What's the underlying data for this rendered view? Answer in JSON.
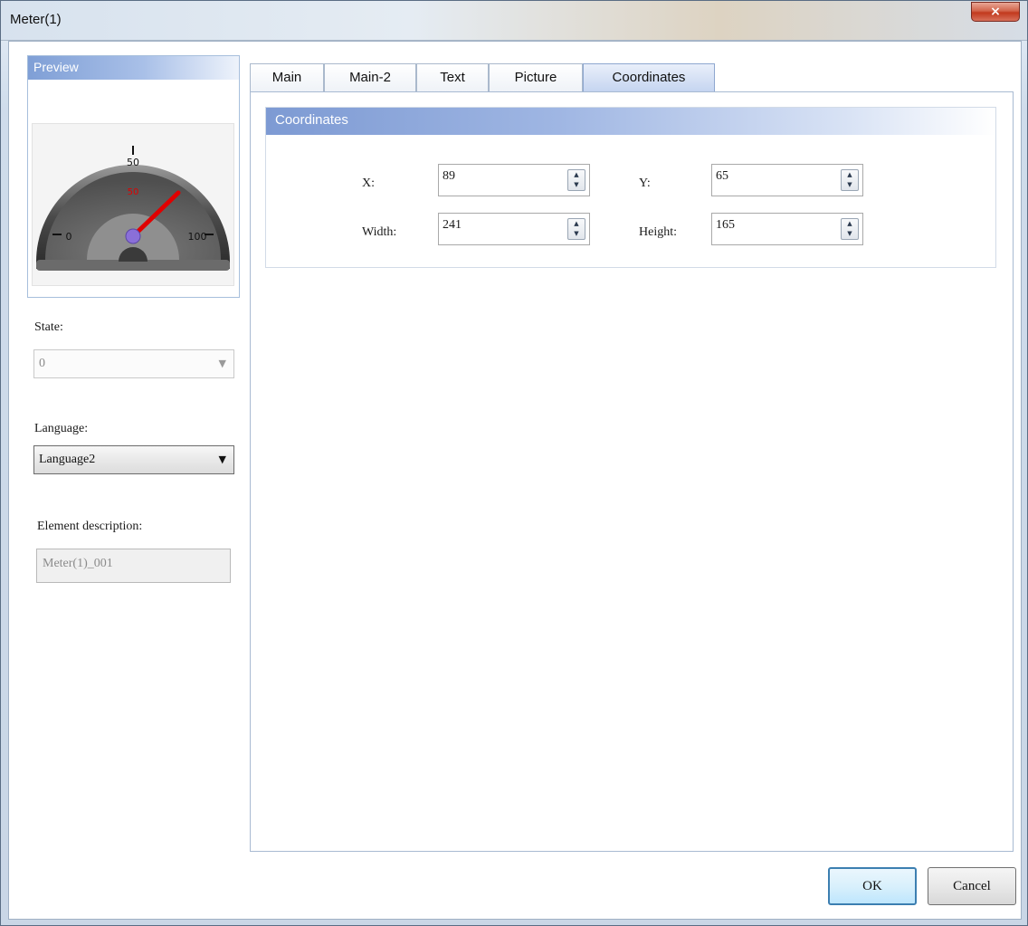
{
  "window": {
    "title": "Meter(1)",
    "close_icon": "×"
  },
  "preview": {
    "header": "Preview",
    "gauge": {
      "min_label": "0",
      "mid_label": "50",
      "mid_value_label": "50",
      "max_label": "100",
      "value": 50
    }
  },
  "left": {
    "state_label": "State:",
    "state_value": "0",
    "language_label": "Language:",
    "language_value": "Language2",
    "element_desc_label": "Element description:",
    "element_desc_value": "Meter(1)_001"
  },
  "tabs": [
    "Main",
    "Main-2",
    "Text",
    "Picture",
    "Coordinates"
  ],
  "active_tab": "Coordinates",
  "coordinates": {
    "header": "Coordinates",
    "x_label": "X:",
    "x_value": "89",
    "y_label": "Y:",
    "y_value": "65",
    "width_label": "Width:",
    "width_value": "241",
    "height_label": "Height:",
    "height_value": "165"
  },
  "buttons": {
    "ok": "OK",
    "cancel": "Cancel"
  },
  "colors": {
    "accent": "#7d9ad3",
    "needle": "#e00000",
    "hub": "#8a6fd8"
  }
}
